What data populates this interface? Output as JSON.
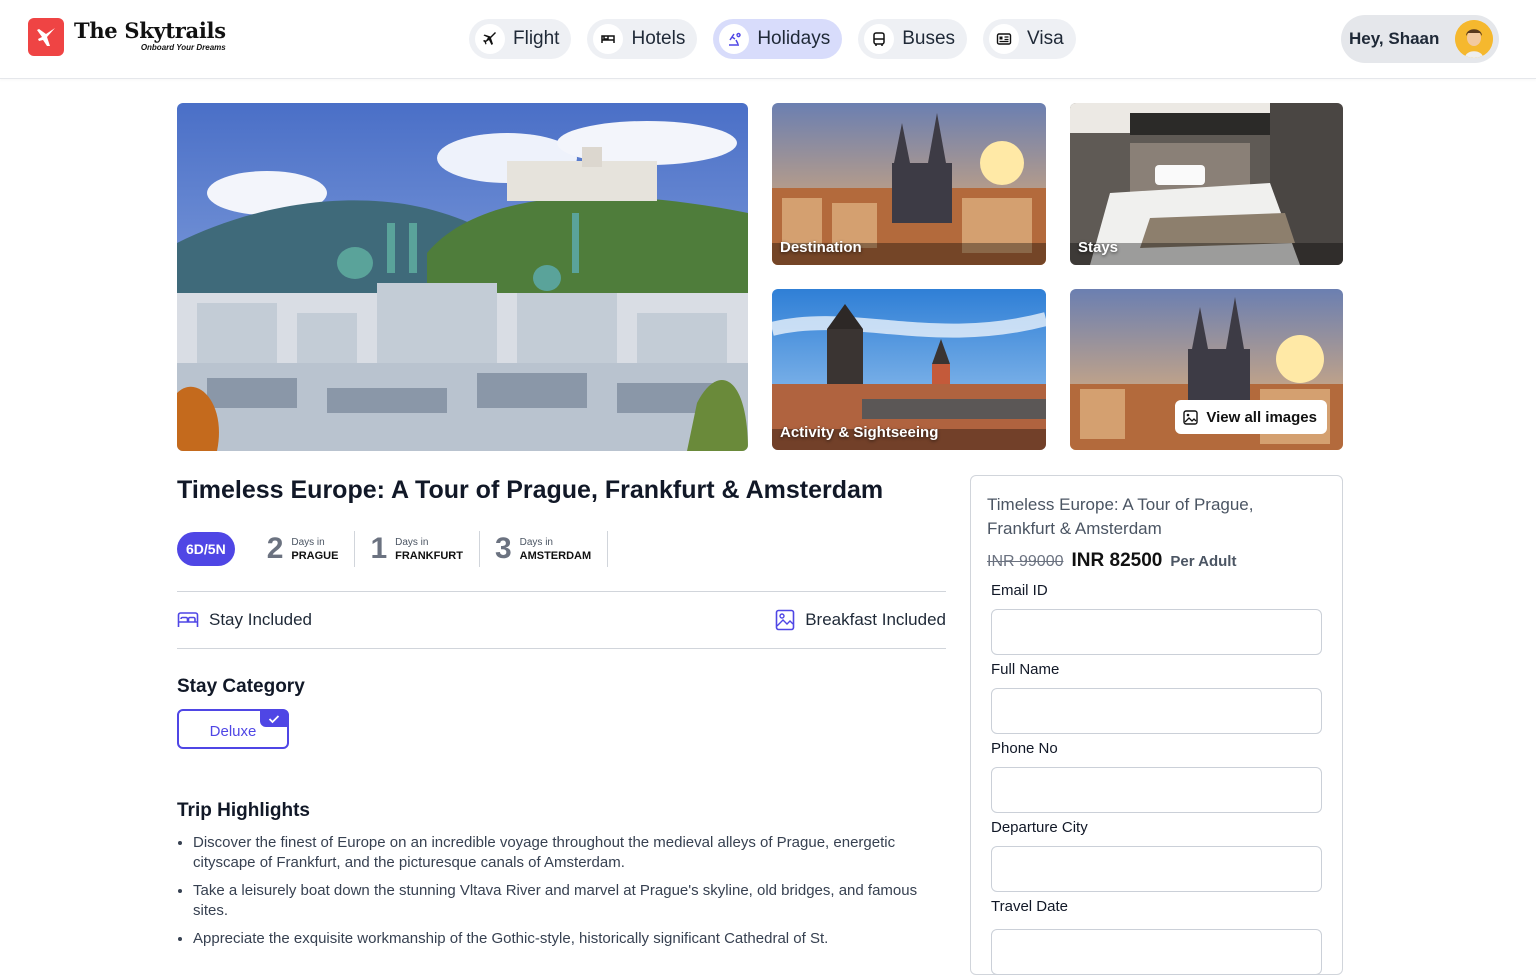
{
  "brand": {
    "title": "The Skytrails",
    "tagline": "Onboard Your Dreams",
    "accent": "#ef4444"
  },
  "nav": [
    {
      "label": "Flight",
      "icon": "plane-icon",
      "active": false
    },
    {
      "label": "Hotels",
      "icon": "bed-icon",
      "active": false
    },
    {
      "label": "Holidays",
      "icon": "beach-icon",
      "active": true
    },
    {
      "label": "Buses",
      "icon": "bus-icon",
      "active": false
    },
    {
      "label": "Visa",
      "icon": "id-card-icon",
      "active": false
    }
  ],
  "user": {
    "greeting": "Hey, Shaan"
  },
  "gallery": {
    "tiles": [
      "Destination",
      "Stays",
      "Activity & Sightseeing"
    ],
    "view_all": "View all images"
  },
  "package": {
    "title": "Timeless Europe: A Tour of Prague, Frankfurt & Amsterdam",
    "duration": "6D/5N",
    "stops": [
      {
        "days": "2",
        "label": "Days in",
        "city": "PRAGUE"
      },
      {
        "days": "1",
        "label": "Days in",
        "city": "FRANKFURT"
      },
      {
        "days": "3",
        "label": "Days in",
        "city": "AMSTERDAM"
      }
    ],
    "inclusions": [
      "Stay Included",
      "Breakfast Included"
    ],
    "stay_category_heading": "Stay Category",
    "stay_category_selected": "Deluxe",
    "highlights_heading": "Trip Highlights",
    "highlights": [
      "Discover the finest of Europe on an incredible voyage throughout the medieval alleys of Prague, energetic cityscape of Frankfurt, and the picturesque canals of Amsterdam.",
      "Take a leisurely boat down the stunning Vltava River and marvel at Prague's skyline, old bridges, and famous sites.",
      "Appreciate the exquisite workmanship of the Gothic-style, historically significant Cathedral of St."
    ]
  },
  "enquiry": {
    "title": "Timeless Europe: A Tour of Prague, Frankfurt & Amsterdam",
    "old_price": "INR 99000",
    "price": "INR 82500",
    "per": "Per Adult",
    "fields": [
      "Email ID",
      "Full Name",
      "Phone No",
      "Departure City",
      "Travel Date"
    ]
  },
  "colors": {
    "primary": "#4f46e5",
    "nav_active": "#d8dcfb"
  }
}
